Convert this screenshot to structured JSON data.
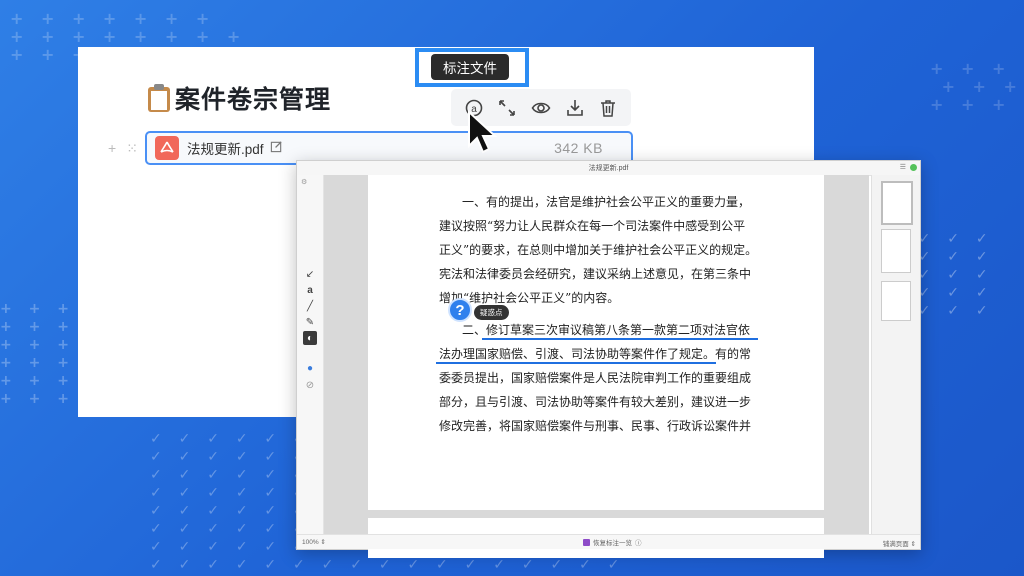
{
  "page": {
    "title": "案件卷宗管理"
  },
  "file": {
    "name": "法规更新.pdf",
    "size": "342 KB"
  },
  "toolbar": {
    "tooltip": "标注文件",
    "buttons": [
      {
        "icon": "annotate-icon"
      },
      {
        "icon": "expand-icon"
      },
      {
        "icon": "eye-icon"
      },
      {
        "icon": "download-icon"
      },
      {
        "icon": "trash-icon"
      }
    ]
  },
  "viewer": {
    "window_title": "法规更新.pdf",
    "zoom": "100% ⇕",
    "show_annotations_label": "恢复标注一览",
    "fit_label": "铺满页面 ⇕",
    "annotation_tag": "疑惑点",
    "document_lines": [
      "一、有的提出，法官是维护社会公平正义的重要力量，",
      "建议按照“努力让人民群众在每一个司法案件中感受到公平",
      "正义”的要求，在总则中增加关于维护社会公平正义的规定。",
      "宪法和法律委员会经研究，建议采纳上述意见，在第三条中",
      "增加“维护社会公平正义”的内容。",
      "二、修订草案三次审议稿第八条第一款第二项对法官依",
      "法办理国家赔偿、引渡、司法协助等案件作了规定。有的常",
      "委委员提出，国家赔偿案件是人民法院审判工作的重要组成",
      "部分，且与引渡、司法协助等案件有较大差别，建议进一步",
      "修改完善，将国家赔偿案件与刑事、民事、行政诉讼案件并"
    ]
  },
  "colors": {
    "accent": "#2b8cf3",
    "background": "#2469db",
    "underline": "#1f6fe0"
  }
}
